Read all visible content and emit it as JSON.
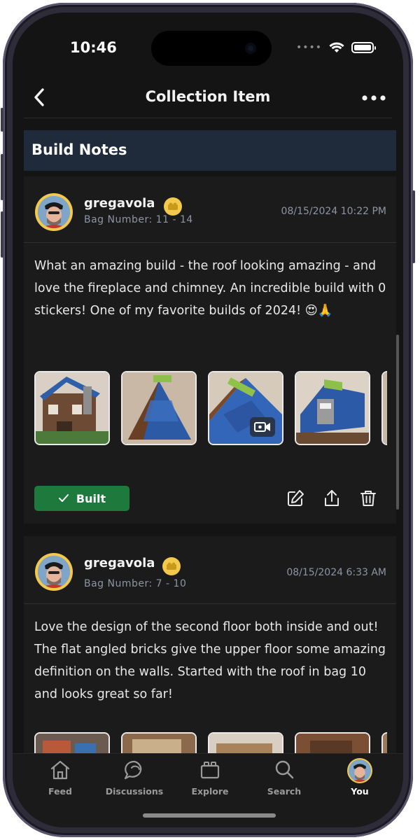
{
  "status": {
    "time": "10:46"
  },
  "nav": {
    "title": "Collection Item"
  },
  "section": {
    "title": "Build Notes"
  },
  "notes": [
    {
      "username": "gregavola",
      "bag": "Bag Number: 11 - 14",
      "timestamp": "08/15/2024 10:22 PM",
      "text": "What an amazing build - the roof looking amazing - and love the fireplace and chimney. An incredible build with 0 stickers! One of my favorite builds of 2024! 😍🙏",
      "built_label": "Built"
    },
    {
      "username": "gregavola",
      "bag": "Bag Number: 7 - 10",
      "timestamp": "08/15/2024 6:33 AM",
      "text": "Love the design of the second floor both inside and out! The flat angled bricks give the upper floor some amazing definition on the walls. Started with the roof in bag 10 and looks great so far!"
    }
  ],
  "tabs": [
    {
      "label": "Feed",
      "icon": "home-icon"
    },
    {
      "label": "Discussions",
      "icon": "chat-bubbles-icon"
    },
    {
      "label": "Explore",
      "icon": "brick-icon"
    },
    {
      "label": "Search",
      "icon": "search-icon"
    },
    {
      "label": "You",
      "icon": "avatar"
    }
  ],
  "colors": {
    "built_green": "#1e7a3c",
    "section_header": "#1f2a3b",
    "badge_yellow": "#f2c94c"
  }
}
